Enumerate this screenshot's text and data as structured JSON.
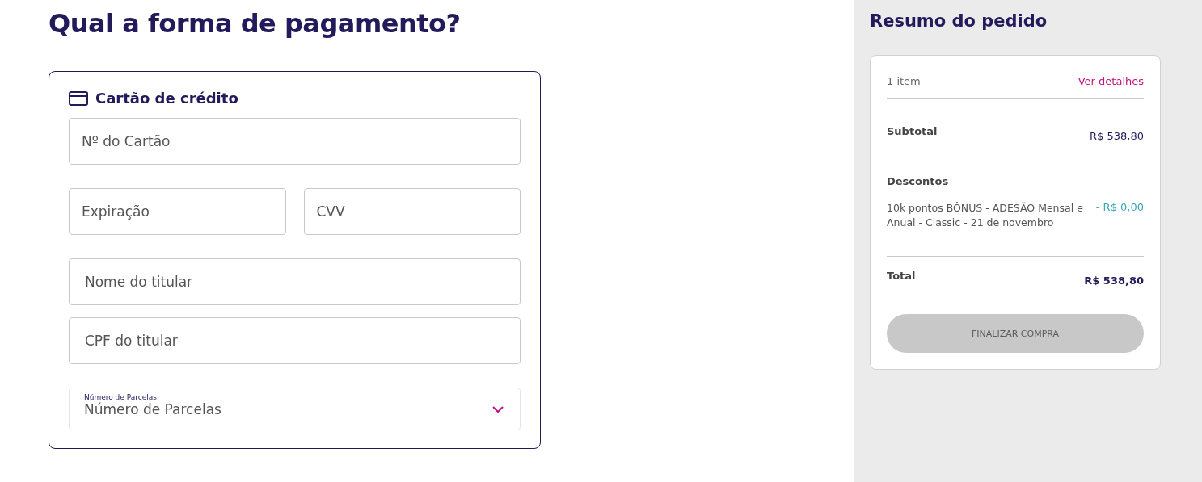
{
  "title": "Qual a forma de pagamento?",
  "payment": {
    "method": "Cartão de crédito",
    "fields": [
      {
        "kind": "text",
        "placeholder": "Nº do Cartão"
      },
      {
        "kind": "pair",
        "items": [
          {
            "placeholder": "Expiração"
          },
          {
            "placeholder": "CVV"
          }
        ]
      },
      {
        "kind": "text",
        "placeholder": "Nome do titular"
      },
      {
        "kind": "text",
        "placeholder": "CPF do titular"
      },
      {
        "kind": "select",
        "label": "Número de Parcelas",
        "value": "Número de Parcelas"
      }
    ]
  },
  "summary": {
    "title": "Resumo do pedido",
    "items_count": "1 item",
    "details_link": "Ver detalhes",
    "subtotal": {
      "label": "Subtotal",
      "value": "R$ 538,80"
    },
    "discounts": {
      "label": "Descontos",
      "items": [
        {
          "name": "10k pontos BÔNUS - ADESÃO Mensal e Anual - Classic - 21 de novembro",
          "value": "- R$ 0,00"
        }
      ]
    },
    "total": {
      "label": "Total",
      "value": "R$ 538,80"
    },
    "button": {
      "label": "FINALIZAR COMPRA",
      "disabled": true
    }
  }
}
